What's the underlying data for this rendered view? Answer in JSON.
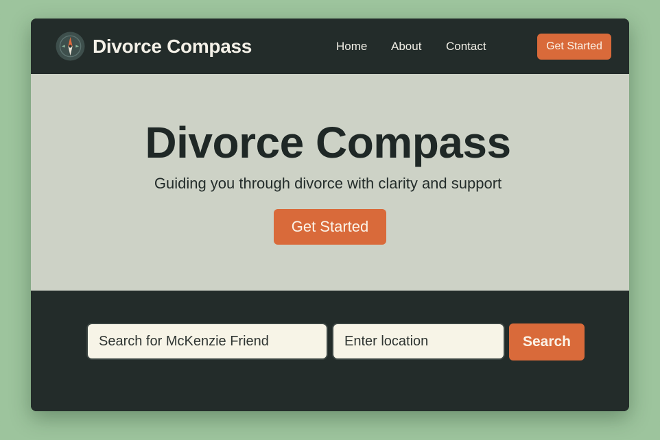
{
  "brand": {
    "name": "Divorce Compass",
    "logo_icon": "compass-icon"
  },
  "nav": {
    "items": [
      {
        "label": "Home"
      },
      {
        "label": "About"
      },
      {
        "label": "Contact"
      }
    ],
    "cta_label": "Get Started"
  },
  "hero": {
    "title": "Divorce Compass",
    "subtitle": "Guiding you through divorce with clarity and support",
    "cta_label": "Get Started"
  },
  "search": {
    "friend_placeholder": "Search for McKenzie Friend",
    "location_placeholder": "Enter location",
    "button_label": "Search"
  },
  "colors": {
    "accent": "#d96a3a",
    "dark": "#232c2a",
    "hero_bg": "#cdd2c6",
    "outer_bg": "#9dc49d",
    "field_bg": "#f7f4e7"
  }
}
